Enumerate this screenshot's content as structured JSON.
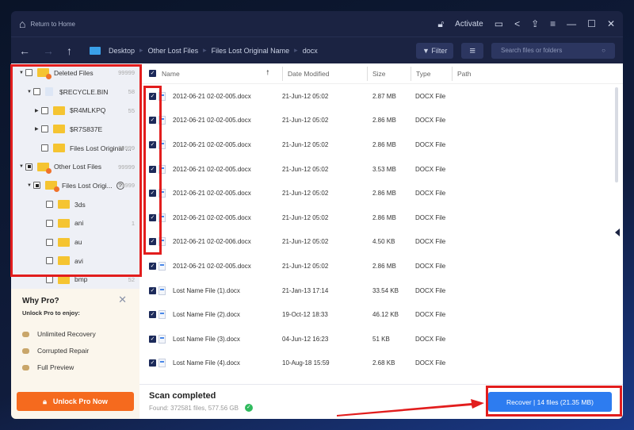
{
  "titlebar": {
    "return_home": "Return to Home",
    "activate": "Activate"
  },
  "nav": {
    "crumbs": [
      "Desktop",
      "Other Lost Files",
      "Files Lost Original Name",
      "docx"
    ],
    "filter": "Filter",
    "search_placeholder": "Search files or folders"
  },
  "tree": [
    {
      "label": "Deleted Files",
      "count": "99999",
      "level": 0,
      "expand": "▼",
      "state": "empty",
      "icon": "orange"
    },
    {
      "label": "$RECYCLE.BIN",
      "count": "58",
      "level": 1,
      "expand": "▼",
      "state": "empty",
      "icon": "recycle"
    },
    {
      "label": "$R4MLKPQ",
      "count": "55",
      "level": 2,
      "expand": "▶",
      "state": "empty",
      "icon": "folder"
    },
    {
      "label": "$R7S837E",
      "count": "",
      "level": 2,
      "expand": "▶",
      "state": "empty",
      "icon": "folder"
    },
    {
      "label": "Files Lost Original ...",
      "count": "99999",
      "level": 2,
      "expand": "",
      "state": "empty",
      "icon": "folder"
    },
    {
      "label": "Other Lost Files",
      "count": "99999",
      "level": 0,
      "expand": "▼",
      "state": "part",
      "icon": "orange"
    },
    {
      "label": "Files Lost Origi...",
      "count": "99999",
      "level": 1,
      "expand": "▼",
      "state": "part",
      "icon": "orange",
      "help": "?"
    },
    {
      "label": "3ds",
      "count": "",
      "level": 3,
      "expand": "",
      "state": "empty",
      "icon": "folder"
    },
    {
      "label": "ani",
      "count": "1",
      "level": 3,
      "expand": "",
      "state": "empty",
      "icon": "folder"
    },
    {
      "label": "au",
      "count": "",
      "level": 3,
      "expand": "",
      "state": "empty",
      "icon": "folder"
    },
    {
      "label": "avi",
      "count": "",
      "level": 3,
      "expand": "",
      "state": "empty",
      "icon": "folder"
    },
    {
      "label": "bmp",
      "count": "52",
      "level": 3,
      "expand": "",
      "state": "empty",
      "icon": "folder"
    }
  ],
  "pro": {
    "title": "Why Pro?",
    "subtitle": "Unlock Pro to enjoy:",
    "features": [
      "Unlimited Recovery",
      "Corrupted Repair",
      "Full Preview"
    ],
    "button": "Unlock Pro Now"
  },
  "table": {
    "headers": {
      "name": "Name",
      "date": "Date Modified",
      "size": "Size",
      "type": "Type",
      "path": "Path"
    },
    "rows": [
      [
        "2012-06-21 02-02-005.docx",
        "21-Jun-12 05:02",
        "2.87 MB",
        "DOCX File"
      ],
      [
        "2012-06-21 02-02-005.docx",
        "21-Jun-12 05:02",
        "2.86 MB",
        "DOCX File"
      ],
      [
        "2012-06-21 02-02-005.docx",
        "21-Jun-12 05:02",
        "2.86 MB",
        "DOCX File"
      ],
      [
        "2012-06-21 02-02-005.docx",
        "21-Jun-12 05:02",
        "3.53 MB",
        "DOCX File"
      ],
      [
        "2012-06-21 02-02-005.docx",
        "21-Jun-12 05:02",
        "2.86 MB",
        "DOCX File"
      ],
      [
        "2012-06-21 02-02-005.docx",
        "21-Jun-12 05:02",
        "2.86 MB",
        "DOCX File"
      ],
      [
        "2012-06-21 02-02-006.docx",
        "21-Jun-12 05:02",
        "4.50 KB",
        "DOCX File"
      ],
      [
        "2012-06-21 02-02-005.docx",
        "21-Jun-12 05:02",
        "2.86 MB",
        "DOCX File"
      ],
      [
        "Lost Name File (1).docx",
        "21-Jan-13 17:14",
        "33.54 KB",
        "DOCX File"
      ],
      [
        "Lost Name File (2).docx",
        "19-Oct-12 18:33",
        "46.12 KB",
        "DOCX File"
      ],
      [
        "Lost Name File (3).docx",
        "04-Jun-12 16:23",
        "51 KB",
        "DOCX File"
      ],
      [
        "Lost Name File (4).docx",
        "10-Aug-18 15:59",
        "2.68 KB",
        "DOCX File"
      ]
    ]
  },
  "status": {
    "title": "Scan completed",
    "found": "Found: 372581 files, 577.56 GB",
    "recover": "Recover | 14 files (21.35 MB)"
  }
}
